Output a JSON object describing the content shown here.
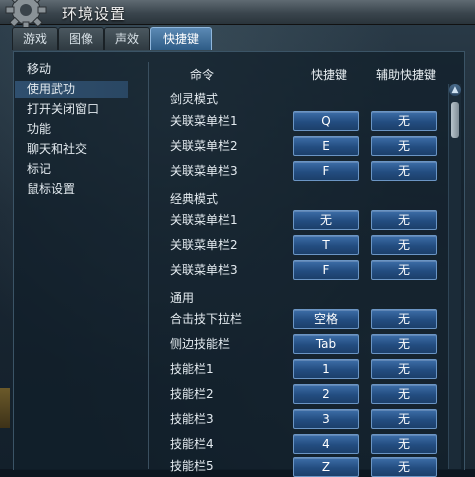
{
  "window": {
    "title": "环境设置"
  },
  "tabs": [
    {
      "label": "游戏"
    },
    {
      "label": "图像"
    },
    {
      "label": "声效"
    },
    {
      "label": "快捷键",
      "active": true
    }
  ],
  "nav": [
    {
      "label": "移动"
    },
    {
      "label": "使用武功",
      "selected": true
    },
    {
      "label": "打开关闭窗口"
    },
    {
      "label": "功能"
    },
    {
      "label": "聊天和社交"
    },
    {
      "label": "标记"
    },
    {
      "label": "鼠标设置"
    }
  ],
  "columns": {
    "command": "命令",
    "hotkey": "快捷键",
    "alt_hotkey": "辅助快捷键"
  },
  "sections": [
    {
      "title": "剑灵模式",
      "rows": [
        {
          "label": "关联菜单栏1",
          "key": "Q",
          "alt": "无"
        },
        {
          "label": "关联菜单栏2",
          "key": "E",
          "alt": "无"
        },
        {
          "label": "关联菜单栏3",
          "key": "F",
          "alt": "无"
        }
      ]
    },
    {
      "title": "经典模式",
      "rows": [
        {
          "label": "关联菜单栏1",
          "key": "无",
          "alt": "无"
        },
        {
          "label": "关联菜单栏2",
          "key": "T",
          "alt": "无"
        },
        {
          "label": "关联菜单栏3",
          "key": "F",
          "alt": "无"
        }
      ]
    },
    {
      "title": "通用",
      "rows": [
        {
          "label": "合击技下拉栏",
          "key": "空格",
          "alt": "无"
        },
        {
          "label": "侧边技能栏",
          "key": "Tab",
          "alt": "无"
        },
        {
          "label": "技能栏1",
          "key": "1",
          "alt": "无"
        },
        {
          "label": "技能栏2",
          "key": "2",
          "alt": "无"
        },
        {
          "label": "技能栏3",
          "key": "3",
          "alt": "无"
        },
        {
          "label": "技能栏4",
          "key": "4",
          "alt": "无"
        },
        {
          "label": "技能栏5",
          "key": "Z",
          "alt": "无"
        }
      ]
    }
  ],
  "scrollbar": {
    "up_icon": "▲"
  },
  "icons": {
    "gear": "gear-icon",
    "scroll_up": "arrow-up-icon"
  },
  "colors": {
    "button": "#2b5c93",
    "tab_active": "#4a79a6",
    "panel": "#13222e"
  }
}
